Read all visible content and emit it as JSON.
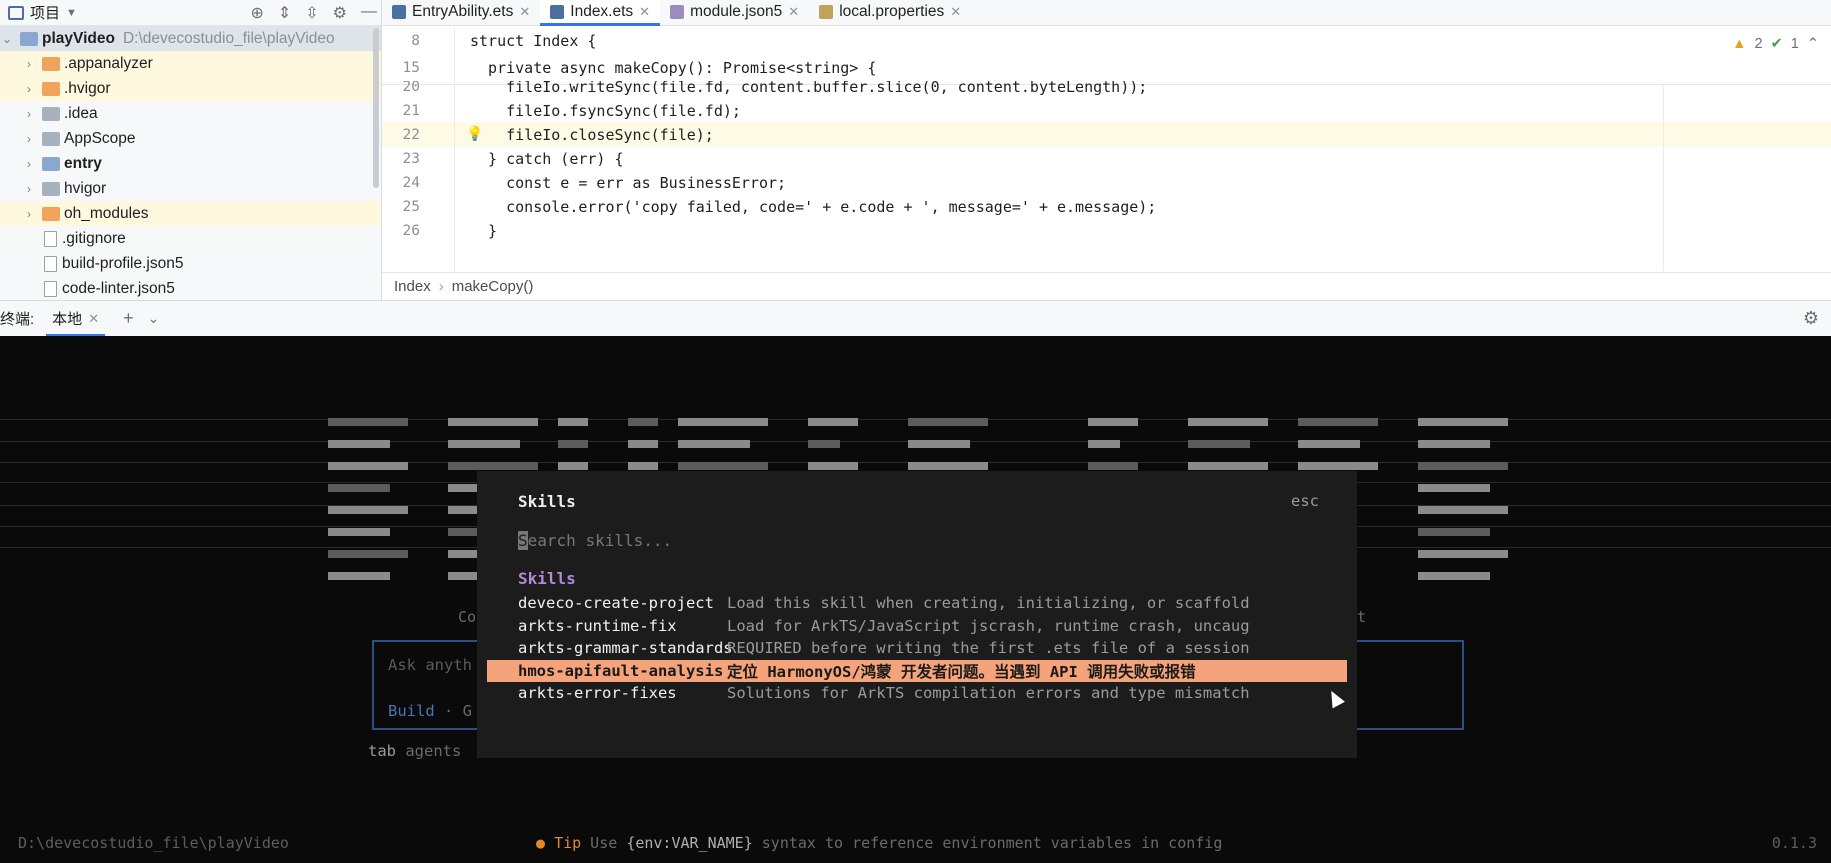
{
  "sidebar": {
    "title": "项目",
    "root": {
      "name": "playVideo",
      "path": "D:\\devecostudio_file\\playVideo"
    },
    "items": [
      {
        "label": ".appanalyzer",
        "type": "folder-orange",
        "expandable": true
      },
      {
        "label": ".hvigor",
        "type": "folder-orange",
        "expandable": true
      },
      {
        "label": ".idea",
        "type": "folder-gray",
        "expandable": true
      },
      {
        "label": "AppScope",
        "type": "folder-gray",
        "expandable": true
      },
      {
        "label": "entry",
        "type": "folder-blue",
        "expandable": true
      },
      {
        "label": "hvigor",
        "type": "folder-gray",
        "expandable": true
      },
      {
        "label": "oh_modules",
        "type": "folder-orange",
        "expandable": true
      },
      {
        "label": ".gitignore",
        "type": "file",
        "expandable": false
      },
      {
        "label": "build-profile.json5",
        "type": "file",
        "expandable": false
      },
      {
        "label": "code-linter.json5",
        "type": "file",
        "expandable": false
      }
    ]
  },
  "editor": {
    "tabs": [
      {
        "label": "EntryAbility.ets",
        "icon": "ets",
        "active": false
      },
      {
        "label": "Index.ets",
        "icon": "ets",
        "active": true
      },
      {
        "label": "module.json5",
        "icon": "json",
        "active": false
      },
      {
        "label": "local.properties",
        "icon": "prop",
        "active": false
      }
    ],
    "sticky": [
      {
        "ln": "8",
        "code": "struct Index {"
      },
      {
        "ln": "15",
        "code": "  private async makeCopy(): Promise<string> {"
      }
    ],
    "lines": [
      {
        "ln": "20",
        "code": "    fileIo.writeSync(file.fd, content.buffer.slice(0, content.byteLength));"
      },
      {
        "ln": "21",
        "code": "    fileIo.fsyncSync(file.fd);"
      },
      {
        "ln": "22",
        "code": "    fileIo.closeSync(file);"
      },
      {
        "ln": "23",
        "code": "  } catch (err) {"
      },
      {
        "ln": "24",
        "code": "    const e = err as BusinessError;"
      },
      {
        "ln": "25",
        "code": "    console.error('copy failed, code=' + e.code + ', message=' + e.message);"
      },
      {
        "ln": "26",
        "code": "  }"
      }
    ],
    "inspections": {
      "warnings": "2",
      "ok": "1"
    },
    "breadcrumb": [
      "Index",
      "makeCopy()"
    ]
  },
  "terminal_header": {
    "label": "终端:",
    "tab": "本地"
  },
  "terminal": {
    "hint_left": "Co",
    "hint_right": "t",
    "prompt_placeholder": "Ask anyth",
    "mode_label": "Build",
    "mode_sep": " · G",
    "tab_hint": "tab",
    "tab_hint_rest": " agents",
    "path": "D:\\devecostudio_file\\playVideo",
    "tip_label": "Tip",
    "tip_text_a": " Use ",
    "tip_key": "{env:VAR_NAME}",
    "tip_text_b": " syntax to reference environment variables in config",
    "version": "0.1.3"
  },
  "skills_dialog": {
    "title": "Skills",
    "esc": "esc",
    "search_placeholder": "earch skills...",
    "search_first": "S",
    "section": "Skills",
    "items": [
      {
        "name": "deveco-create-project",
        "desc": "Load this skill when creating, initializing, or scaffold",
        "selected": false
      },
      {
        "name": "arkts-runtime-fix",
        "desc": "Load for ArkTS/JavaScript jscrash, runtime crash, uncaug",
        "selected": false
      },
      {
        "name": "arkts-grammar-standards",
        "desc": "REQUIRED before writing the first .ets file of a session",
        "selected": false
      },
      {
        "name": "hmos-apifault-analysis",
        "desc": "定位 HarmonyOS/鸿蒙 开发者问题。当遇到 API 调用失败或报错",
        "selected": true
      },
      {
        "name": "arkts-error-fixes",
        "desc": "Solutions for ArkTS compilation errors and type mismatch",
        "selected": false
      }
    ]
  },
  "colors": {
    "terminal_bg": "#0a0a0a",
    "dialog_bg": "#1c1c1c",
    "selection": "#f4a37a",
    "section_accent": "#b18ad8",
    "prompt_border": "#2f4f82",
    "accent_blue": "#3574f0"
  }
}
